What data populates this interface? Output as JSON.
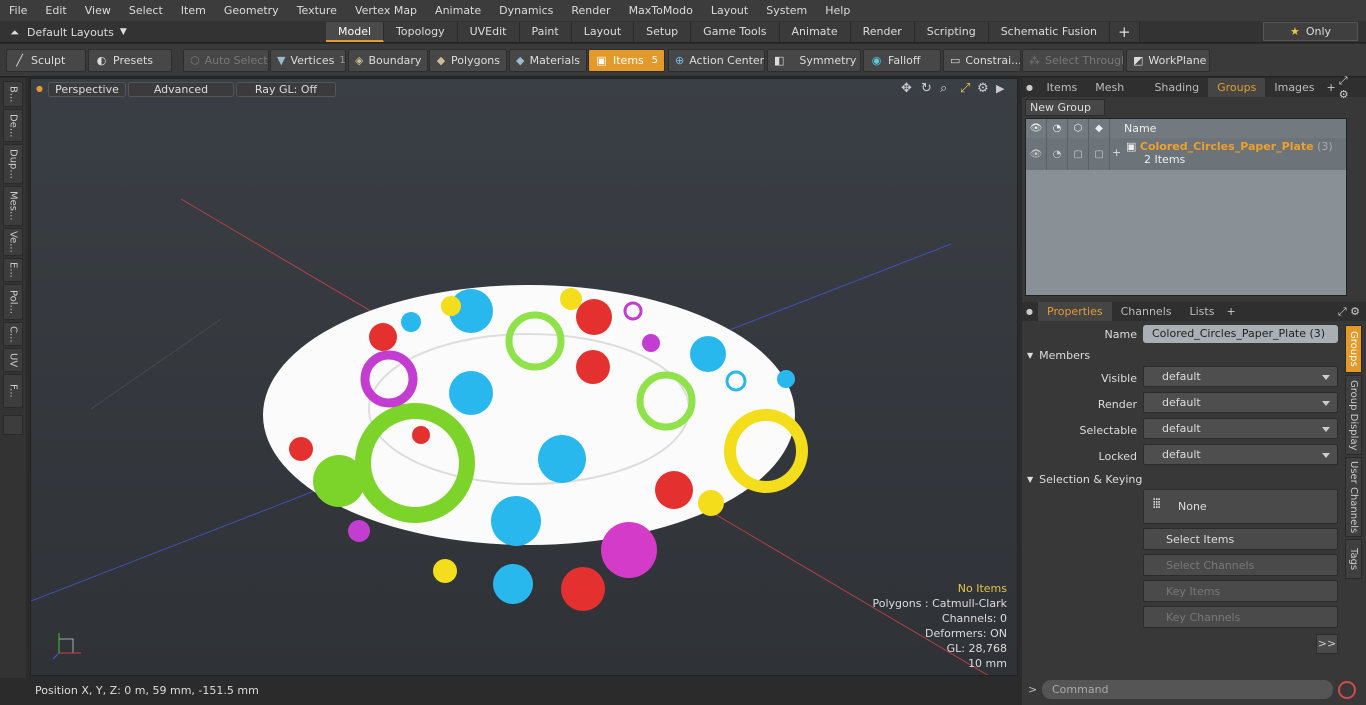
{
  "menu": [
    "File",
    "Edit",
    "View",
    "Select",
    "Item",
    "Geometry",
    "Texture",
    "Vertex Map",
    "Animate",
    "Dynamics",
    "Render",
    "MaxToModo",
    "Layout",
    "System",
    "Help"
  ],
  "layouts": {
    "label": "Default Layouts"
  },
  "main_tabs": [
    "Model",
    "Topology",
    "UVEdit",
    "Paint",
    "Layout",
    "Setup",
    "Game Tools",
    "Animate",
    "Render",
    "Scripting",
    "Schematic Fusion"
  ],
  "only_label": "Only",
  "toolbar": {
    "sculpt": "Sculpt",
    "presets": "Presets",
    "auto_select": "Auto Select",
    "vertices": "Vertices",
    "vertices_count": "1",
    "boundary": "Boundary",
    "polygons": "Polygons",
    "materials": "Materials",
    "items": "Items",
    "items_count": "5",
    "action_center": "Action Center",
    "symmetry": "Symmetry",
    "falloff": "Falloff",
    "constraints": "Constrai...",
    "select_through": "Select Through",
    "workplane": "WorkPlane"
  },
  "left_tabs": [
    "B...",
    "De...",
    "Dup...",
    "Mes...",
    "Ve...",
    "E...",
    "Pol...",
    "C...",
    "UV",
    "F..."
  ],
  "viewport": {
    "view": "Perspective",
    "advanced": "Advanced",
    "raygl": "Ray GL: Off",
    "info": {
      "items": "No Items",
      "polygons": "Polygons : Catmull-Clark",
      "channels": "Channels: 0",
      "deformers": "Deformers: ON",
      "gl": "GL: 28,768",
      "scale": "10 mm"
    }
  },
  "status": {
    "position": "Position X, Y, Z:   0 m, 59 mm, -151.5 mm"
  },
  "top_panel_tabs": [
    "Items",
    "Mesh ...",
    "Shading",
    "Groups",
    "Images"
  ],
  "groups": {
    "new_group": "New Group",
    "name_header": "Name",
    "group_name": "Colored_Circles_Paper_Plate",
    "group_count": "(3)",
    "group_items": "2 Items"
  },
  "bottom_panel_tabs": [
    "Properties",
    "Channels",
    "Lists"
  ],
  "properties": {
    "name_label": "Name",
    "name_value": "Colored_Circles_Paper_Plate (3)",
    "members": "Members",
    "visible_label": "Visible",
    "visible": "default",
    "render_label": "Render",
    "render": "default",
    "selectable_label": "Selectable",
    "selectable": "default",
    "locked_label": "Locked",
    "locked": "default",
    "selection_keying": "Selection & Keying",
    "none": "None",
    "select_items": "Select Items",
    "select_channels": "Select Channels",
    "key_items": "Key Items",
    "key_channels": "Key Channels",
    "more": ">>"
  },
  "side_tabs": [
    "Groups",
    "Group Display",
    "User Channels",
    "Tags"
  ],
  "command": {
    "placeholder": "Command"
  },
  "colors": {
    "accent": "#e69b2e"
  }
}
